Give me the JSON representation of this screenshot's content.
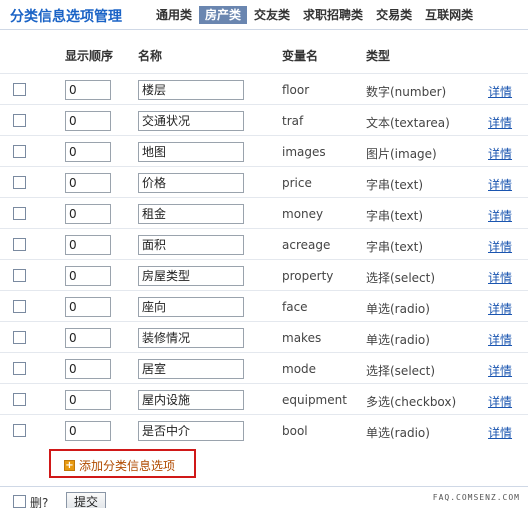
{
  "header": {
    "title": "分类信息选项管理",
    "tabs": [
      {
        "label": "通用类",
        "active": false
      },
      {
        "label": "房产类",
        "active": true
      },
      {
        "label": "交友类",
        "active": false
      },
      {
        "label": "求职招聘类",
        "active": false
      },
      {
        "label": "交易类",
        "active": false
      },
      {
        "label": "互联网类",
        "active": false
      }
    ]
  },
  "table": {
    "columns": {
      "order": "显示顺序",
      "name": "名称",
      "variable": "变量名",
      "type": "类型"
    },
    "rows": [
      {
        "order": "0",
        "name": "楼层",
        "variable": "floor",
        "type": "数字(number)",
        "detail": "详情"
      },
      {
        "order": "0",
        "name": "交通状况",
        "variable": "traf",
        "type": "文本(textarea)",
        "detail": "详情"
      },
      {
        "order": "0",
        "name": "地图",
        "variable": "images",
        "type": "图片(image)",
        "detail": "详情"
      },
      {
        "order": "0",
        "name": "价格",
        "variable": "price",
        "type": "字串(text)",
        "detail": "详情"
      },
      {
        "order": "0",
        "name": "租金",
        "variable": "money",
        "type": "字串(text)",
        "detail": "详情"
      },
      {
        "order": "0",
        "name": "面积",
        "variable": "acreage",
        "type": "字串(text)",
        "detail": "详情"
      },
      {
        "order": "0",
        "name": "房屋类型",
        "variable": "property",
        "type": "选择(select)",
        "detail": "详情"
      },
      {
        "order": "0",
        "name": "座向",
        "variable": "face",
        "type": "单选(radio)",
        "detail": "详情"
      },
      {
        "order": "0",
        "name": "装修情况",
        "variable": "makes",
        "type": "单选(radio)",
        "detail": "详情"
      },
      {
        "order": "0",
        "name": "居室",
        "variable": "mode",
        "type": "选择(select)",
        "detail": "详情"
      },
      {
        "order": "0",
        "name": "屋内设施",
        "variable": "equipment",
        "type": "多选(checkbox)",
        "detail": "详情"
      },
      {
        "order": "0",
        "name": "是否中介",
        "variable": "bool",
        "type": "单选(radio)",
        "detail": "详情"
      }
    ]
  },
  "add_button": {
    "label": "添加分类信息选项",
    "icon": "plus-icon",
    "highlight_color": "#d01818"
  },
  "footer": {
    "delete_label": "删?",
    "submit_label": "提交",
    "watermark": "FAQ.COMSENZ.COM"
  },
  "colors": {
    "title": "#1a63c6",
    "active_tab_bg": "#6a86b0",
    "link": "#1a55b0"
  }
}
